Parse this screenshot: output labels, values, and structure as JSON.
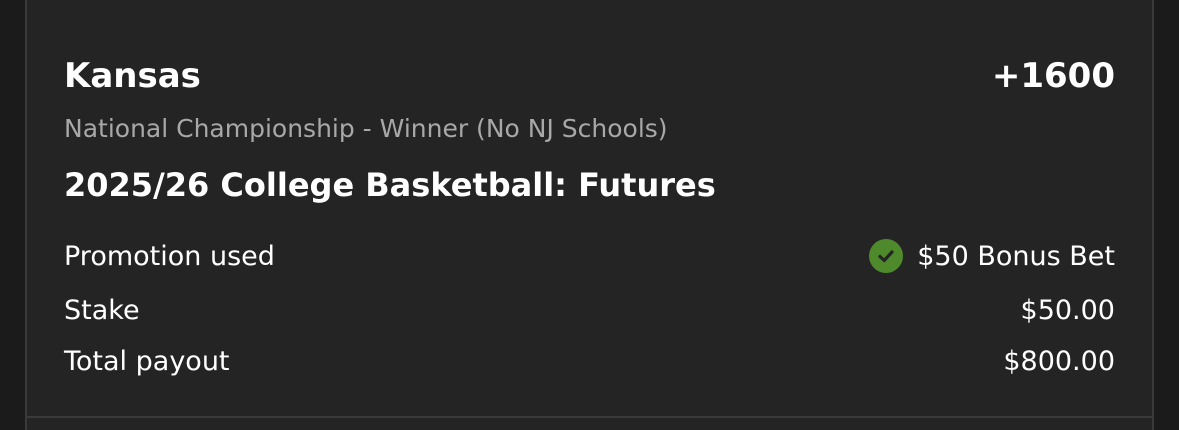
{
  "bet": {
    "selection": "Kansas",
    "odds": "+1600",
    "market": "National Championship - Winner (No NJ Schools)",
    "event": "2025/26 College Basketball: Futures"
  },
  "details": {
    "promotion_label": "Promotion used",
    "promotion_value": "$50 Bonus Bet",
    "stake_label": "Stake",
    "stake_value": "$50.00",
    "payout_label": "Total payout",
    "payout_value": "$800.00"
  },
  "icons": {
    "promotion_icon": "check-circle-icon"
  },
  "colors": {
    "background": "#242424",
    "text_primary": "#ffffff",
    "text_secondary": "#a8a8a8",
    "success_green": "#4e8a2c"
  }
}
